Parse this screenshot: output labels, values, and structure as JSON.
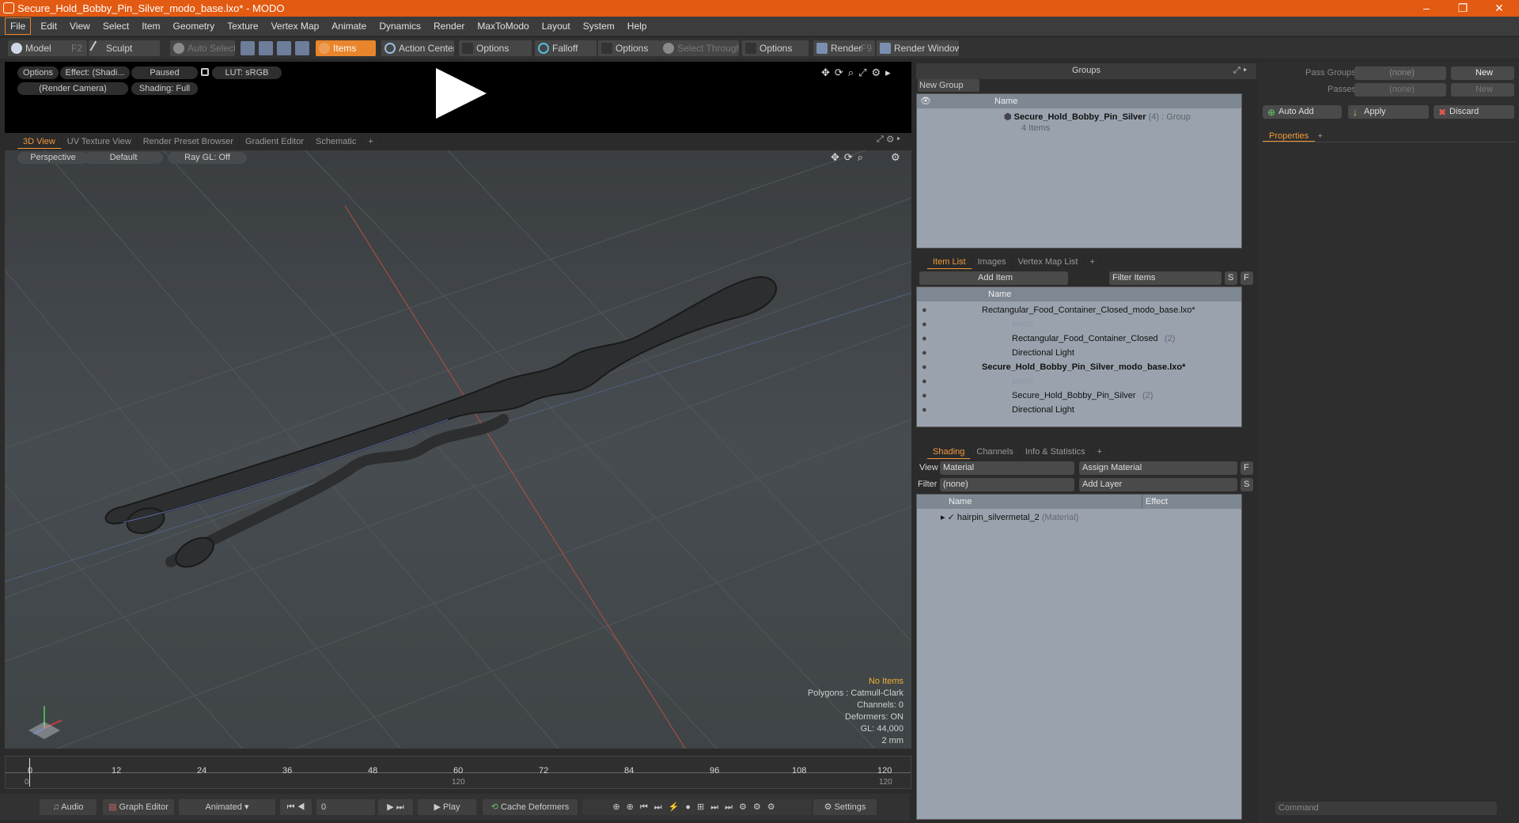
{
  "window": {
    "title": "Secure_Hold_Bobby_Pin_Silver_modo_base.lxo* - MODO",
    "minimize": "–",
    "maximize": "❐",
    "close": "✕"
  },
  "menu": [
    "File",
    "Edit",
    "View",
    "Select",
    "Item",
    "Geometry",
    "Texture",
    "Vertex Map",
    "Animate",
    "Dynamics",
    "Render",
    "MaxToModo",
    "Layout",
    "System",
    "Help"
  ],
  "toolbar": {
    "model": "Model",
    "model_key": "F2",
    "sculpt": "Sculpt",
    "auto_select": "Auto Select",
    "items": "Items",
    "action_center": "Action Center",
    "options1": "Options",
    "falloff": "Falloff",
    "options2": "Options",
    "select_through": "Select Through",
    "options3": "Options",
    "render": "Render",
    "render_key": "F9",
    "render_window": "Render Window"
  },
  "preview": {
    "options": "Options",
    "effect": "Effect: (Shadi...",
    "paused": "Paused",
    "lut": "LUT: sRGB",
    "camera": "(Render Camera)",
    "shading": "Shading: Full"
  },
  "view_tabs": [
    "3D View",
    "UV Texture View",
    "Render Preset Browser",
    "Gradient Editor",
    "Schematic",
    "+"
  ],
  "viewport": {
    "perspective": "Perspective",
    "default": "Default",
    "raygl": "Ray GL: Off",
    "no_items": "No Items",
    "polygons": "Polygons : Catmull-Clark",
    "channels": "Channels: 0",
    "deformers": "Deformers: ON",
    "gl": "GL: 44,000",
    "scale": "2 mm"
  },
  "timeline": {
    "ticks": [
      "0",
      "12",
      "24",
      "36",
      "48",
      "60",
      "72",
      "84",
      "96",
      "108",
      "120"
    ],
    "sub_left": "0",
    "sub_mid": "120",
    "sub_right": "120"
  },
  "transport": {
    "audio": "Audio",
    "graph_editor": "Graph Editor",
    "animated": "Animated",
    "frame": "0",
    "play": "Play",
    "cache": "Cache Deformers",
    "settings": "Settings"
  },
  "groups": {
    "title": "Groups",
    "new_group": "New Group",
    "col_name": "Name",
    "item_name": "Secure_Hold_Bobby_Pin_Silver",
    "item_count": "(4)",
    "item_type": ": Group",
    "item_sub": "4 Items"
  },
  "itemlist": {
    "tabs": [
      "Item List",
      "Images",
      "Vertex Map List",
      "+"
    ],
    "add_item": "Add Item",
    "filter": "Filter Items",
    "s": "S",
    "f": "F",
    "col_name": "Name",
    "rows": [
      {
        "label": "Rectangular_Food_Container_Closed_modo_base.lxo*",
        "extra": "",
        "dim": false,
        "bold": false,
        "indent": 0
      },
      {
        "label": "Mesh",
        "extra": "",
        "dim": true,
        "bold": false,
        "indent": 1
      },
      {
        "label": "Rectangular_Food_Container_Closed",
        "extra": "(2)",
        "dim": false,
        "bold": false,
        "indent": 1
      },
      {
        "label": "Directional Light",
        "extra": "",
        "dim": false,
        "bold": false,
        "indent": 1
      },
      {
        "label": "Secure_Hold_Bobby_Pin_Silver_modo_base.lxo*",
        "extra": "",
        "dim": false,
        "bold": true,
        "indent": 0
      },
      {
        "label": "Mesh",
        "extra": "",
        "dim": true,
        "bold": false,
        "indent": 1
      },
      {
        "label": "Secure_Hold_Bobby_Pin_Silver",
        "extra": "(2)",
        "dim": false,
        "bold": false,
        "indent": 1
      },
      {
        "label": "Directional Light",
        "extra": "",
        "dim": false,
        "bold": false,
        "indent": 1
      }
    ]
  },
  "shading": {
    "tabs": [
      "Shading",
      "Channels",
      "Info & Statistics",
      "+"
    ],
    "view_label": "View",
    "view_value": "Material",
    "assign": "Assign Material",
    "filter_label": "Filter",
    "filter_value": "(none)",
    "add_layer": "Add Layer",
    "f": "F",
    "s": "S",
    "col_name": "Name",
    "col_effect": "Effect",
    "material": "hairpin_silvermetal_2",
    "material_type": "(Material)"
  },
  "right": {
    "pass_groups": "Pass Groups",
    "passes": "Passes",
    "none1": "(none)",
    "none2": "(none)",
    "new1": "New",
    "new2": "New",
    "auto_add": "Auto Add",
    "apply": "Apply",
    "discard": "Discard",
    "properties": "Properties",
    "plus": "+",
    "command": "Command"
  }
}
